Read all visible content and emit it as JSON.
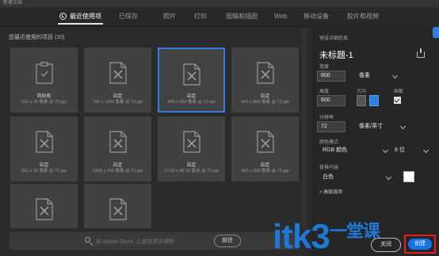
{
  "window": {
    "title": "新建文档"
  },
  "tabs": [
    {
      "label": "最近使用项",
      "active": true
    },
    {
      "label": "已保存"
    },
    {
      "label": "照片"
    },
    {
      "label": "打印"
    },
    {
      "label": "图稿和插图"
    },
    {
      "label": "Web"
    },
    {
      "label": "移动设备"
    },
    {
      "label": "胶片和视频"
    }
  ],
  "recent": {
    "section_label": "您最近使用的项目 (10)",
    "items": [
      {
        "name": "剪贴板",
        "desc": "532 x 20 像素 @ 72 ppi",
        "icon": "clipboard-icon"
      },
      {
        "name": "自定",
        "desc": "750 x 1200 像素 @ 72 ppi",
        "icon": "custom-doc-icon"
      },
      {
        "name": "自定",
        "desc": "800 x 600 像素 @ 72 ppi",
        "icon": "custom-doc-icon",
        "selected": true
      },
      {
        "name": "自定",
        "desc": "600 x 800 像素 @ 72 ppi",
        "icon": "custom-doc-icon"
      },
      {
        "name": "自定",
        "desc": "532 x 20 像素 @ 72 ppi",
        "icon": "custom-doc-icon"
      },
      {
        "name": "自定",
        "desc": "1366 x 768 像素 @ 72 ppi",
        "icon": "custom-doc-icon"
      },
      {
        "name": "自定",
        "desc": "27.09 x 48.19 厘米 @ 72 ppi",
        "icon": "custom-doc-icon"
      },
      {
        "name": "自定",
        "desc": "400 x 300 像素 @ 72 ppi",
        "icon": "custom-doc-icon"
      },
      {
        "name": "",
        "desc": "",
        "icon": "custom-doc-icon"
      },
      {
        "name": "",
        "desc": "",
        "icon": "custom-doc-icon"
      }
    ]
  },
  "search": {
    "placeholder": "在 Adobe Stock 上查找更多模板",
    "go_label": "前往"
  },
  "details": {
    "header": "预设详细信息",
    "doc_title": "未标题-1",
    "width_label": "宽度",
    "width_value": "800",
    "width_unit": "像素",
    "height_label": "高度",
    "height_value": "600",
    "orientation_label": "方向",
    "artboard_label": "画板",
    "resolution_label": "分辨率",
    "resolution_value": "72",
    "resolution_unit": "像素/英寸",
    "color_mode_label": "颜色模式",
    "color_mode_value": "RGB 颜色",
    "bit_depth_value": "8 位",
    "bg_label": "背景内容",
    "bg_value": "白色",
    "advanced_label": "> 高级选项"
  },
  "footer": {
    "close_label": "关闭",
    "create_label": "创建"
  },
  "watermark": {
    "text": "itk3",
    "cn": "一堂课"
  },
  "colors": {
    "accent": "#1473e6",
    "selection": "#2d7fe0",
    "highlight": "#e02020"
  }
}
